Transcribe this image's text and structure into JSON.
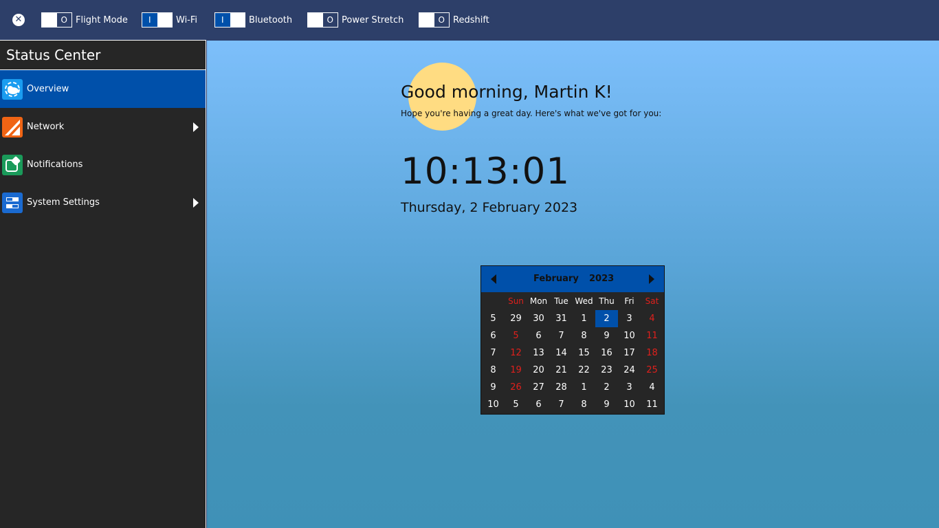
{
  "topbar": {
    "close_symbol": "✕",
    "toggles": [
      {
        "label": "Flight Mode",
        "state": "off",
        "on_text": "",
        "off_text": "O"
      },
      {
        "label": "Wi-Fi",
        "state": "on",
        "on_text": "I",
        "off_text": ""
      },
      {
        "label": "Bluetooth",
        "state": "on",
        "on_text": "I",
        "off_text": ""
      },
      {
        "label": "Power Stretch",
        "state": "off",
        "on_text": "",
        "off_text": "O"
      },
      {
        "label": "Redshift",
        "state": "off",
        "on_text": "",
        "off_text": "O"
      }
    ]
  },
  "sidebar": {
    "title": "Status Center",
    "items": [
      {
        "label": "Overview",
        "icon": "overview-icon",
        "icon_color": "#1a9cf0",
        "active": true,
        "has_submenu": false
      },
      {
        "label": "Network",
        "icon": "network-icon",
        "icon_color": "#f06414",
        "active": false,
        "has_submenu": true
      },
      {
        "label": "Notifications",
        "icon": "notifications-icon",
        "icon_color": "#1a9a5a",
        "active": false,
        "has_submenu": false
      },
      {
        "label": "System Settings",
        "icon": "system-settings-icon",
        "icon_color": "#1a6ad0",
        "active": false,
        "has_submenu": true
      }
    ]
  },
  "main": {
    "greeting": "Good morning, Martin K!",
    "subline": "Hope you're having a great day. Here's what we've got for you:",
    "clock": "10:13:01",
    "date": "Thursday, 2 February 2023"
  },
  "calendar": {
    "month": "February",
    "year": "2023",
    "weekdays": [
      "Sun",
      "Mon",
      "Tue",
      "Wed",
      "Thu",
      "Fri",
      "Sat"
    ],
    "weeks": [
      {
        "num": "5",
        "days": [
          "29",
          "30",
          "31",
          "1",
          "2",
          "3",
          "4"
        ]
      },
      {
        "num": "6",
        "days": [
          "5",
          "6",
          "7",
          "8",
          "9",
          "10",
          "11"
        ]
      },
      {
        "num": "7",
        "days": [
          "12",
          "13",
          "14",
          "15",
          "16",
          "17",
          "18"
        ]
      },
      {
        "num": "8",
        "days": [
          "19",
          "20",
          "21",
          "22",
          "23",
          "24",
          "25"
        ]
      },
      {
        "num": "9",
        "days": [
          "26",
          "27",
          "28",
          "1",
          "2",
          "3",
          "4"
        ]
      },
      {
        "num": "10",
        "days": [
          "5",
          "6",
          "7",
          "8",
          "9",
          "10",
          "11"
        ]
      }
    ],
    "selected_day": "2",
    "colors": {
      "accent": "#0050aa",
      "weekend": "#e0201c"
    }
  }
}
